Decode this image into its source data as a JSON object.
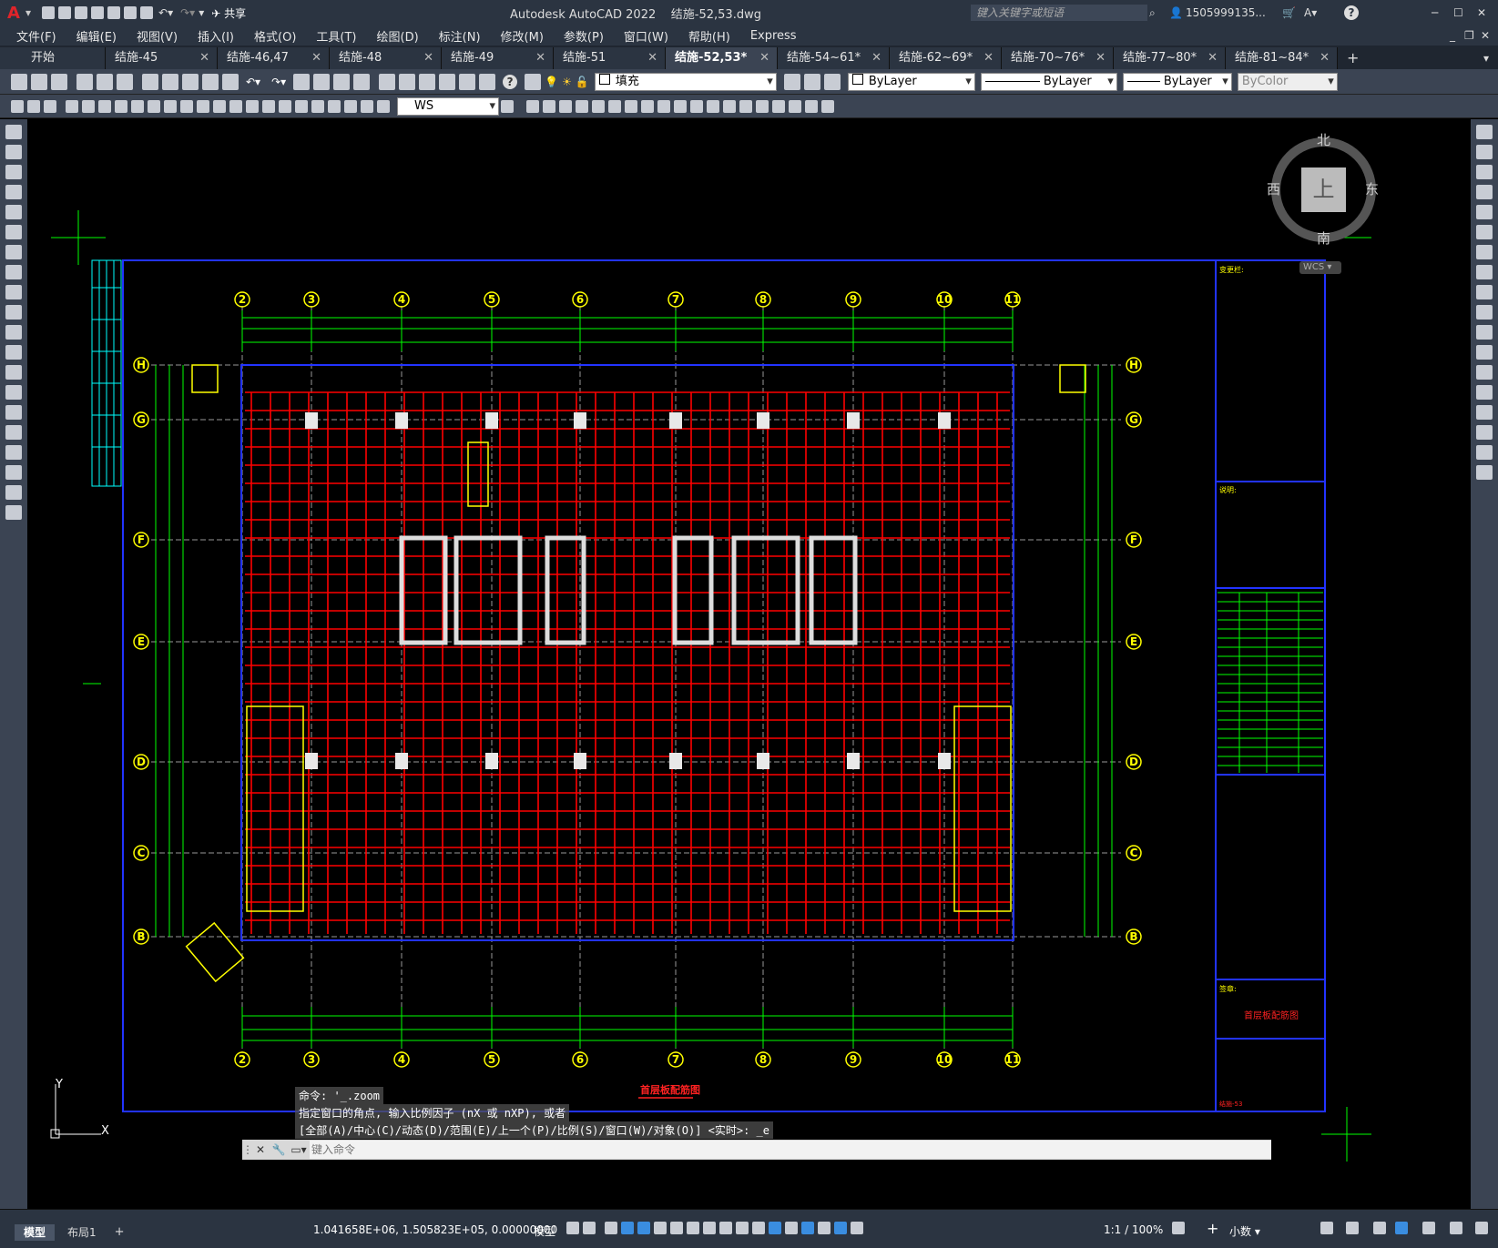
{
  "app": {
    "title": "Autodesk AutoCAD 2022",
    "file": "结施-52,53.dwg",
    "search_placeholder": "键入关键字或短语",
    "user": "1505999135...",
    "share_label": "共享",
    "logo": "A"
  },
  "menu": [
    "文件(F)",
    "编辑(E)",
    "视图(V)",
    "插入(I)",
    "格式(O)",
    "工具(T)",
    "绘图(D)",
    "标注(N)",
    "修改(M)",
    "参数(P)",
    "窗口(W)",
    "帮助(H)",
    "Express"
  ],
  "tabs": [
    {
      "label": "开始",
      "active": false,
      "closable": false
    },
    {
      "label": "结施-45",
      "active": false,
      "closable": true
    },
    {
      "label": "结施-46,47",
      "active": false,
      "closable": true
    },
    {
      "label": "结施-48",
      "active": false,
      "closable": true
    },
    {
      "label": "结施-49",
      "active": false,
      "closable": true
    },
    {
      "label": "结施-51",
      "active": false,
      "closable": true
    },
    {
      "label": "结施-52,53*",
      "active": true,
      "closable": true
    },
    {
      "label": "结施-54~61*",
      "active": false,
      "closable": true
    },
    {
      "label": "结施-62~69*",
      "active": false,
      "closable": true
    },
    {
      "label": "结施-70~76*",
      "active": false,
      "closable": true
    },
    {
      "label": "结施-77~80*",
      "active": false,
      "closable": true
    },
    {
      "label": "结施-81~84*",
      "active": false,
      "closable": true
    }
  ],
  "toolbar": {
    "layer": "填充",
    "color": "ByLayer",
    "linetype": "ByLayer",
    "lineweight": "ByLayer",
    "plotstyle": "ByColor",
    "ucs": "WS"
  },
  "viewcube": {
    "north": "北",
    "south": "南",
    "east": "东",
    "west": "西",
    "top": "上",
    "wcs": "WCS"
  },
  "drawing": {
    "grid_cols": [
      "2",
      "3",
      "4",
      "5",
      "6",
      "7",
      "8",
      "9",
      "10",
      "11"
    ],
    "grid_rows": [
      "H",
      "G",
      "F",
      "E",
      "D",
      "C",
      "B"
    ],
    "plan_title": "首层板配筋图",
    "notes_title": "说明:",
    "rev_title": "变更栏:",
    "seal_title": "签章:",
    "table_title": "首层板配筋图",
    "table_code": "结施-53"
  },
  "command": {
    "history": [
      "命令: '_.zoom",
      "指定窗口的角点, 输入比例因子 (nX 或 nXP), 或者",
      "[全部(A)/中心(C)/动态(D)/范围(E)/上一个(P)/比例(S)/窗口(W)/对象(O)] <实时>: _e"
    ],
    "placeholder": "键入命令"
  },
  "layout_tabs": {
    "model": "模型",
    "layout1": "布局1",
    "add": "+"
  },
  "status": {
    "coords": "1.041658E+06, 1.505823E+05, 0.00000000",
    "space": "模型",
    "scale": "1:1 / 100%",
    "units": "小数"
  }
}
